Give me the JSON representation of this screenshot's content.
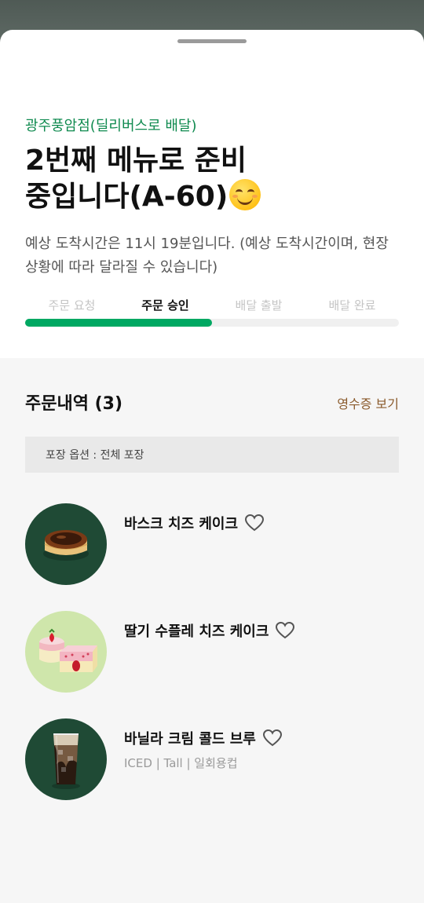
{
  "store": {
    "name": "광주풍암점(딜리버스로 배달)"
  },
  "status": {
    "line1": "2번째 메뉴로 준비",
    "line2": "중입니다(A-60)",
    "emoji_icon": "smiling-face-icon"
  },
  "eta": {
    "text": "예상 도착시간은 11시 19분입니다. (예상 도착시간이며, 현장 상황에 따라 달라질 수 있습니다)"
  },
  "steps": [
    {
      "label": "주문 요청",
      "state": "done"
    },
    {
      "label": "주문 승인",
      "state": "active"
    },
    {
      "label": "배달 출발",
      "state": "pending"
    },
    {
      "label": "배달 완료",
      "state": "pending"
    }
  ],
  "progress": {
    "fraction": 0.5,
    "color": "#00a862"
  },
  "order": {
    "title": "주문내역 (3)",
    "receipt_label": "영수증 보기",
    "packing_option": "포장 옵션 : 전체 포장",
    "items": [
      {
        "name": "바스크 치즈 케이크",
        "option": "",
        "thumb_icon": "basque-cheesecake-image"
      },
      {
        "name": "딸기 수플레 치즈 케이크",
        "option": "",
        "thumb_icon": "strawberry-souffle-cheesecake-image"
      },
      {
        "name": "바닐라 크림 콜드 브루",
        "option": "ICED | Tall | 일회용컵",
        "thumb_icon": "vanilla-cream-cold-brew-image"
      }
    ]
  },
  "colors": {
    "brand_green": "#0f8a4f",
    "accent_brown": "#8a5a2b",
    "thumb_dark_green": "#1f4a35",
    "thumb_light_green": "#cfe6ab"
  }
}
